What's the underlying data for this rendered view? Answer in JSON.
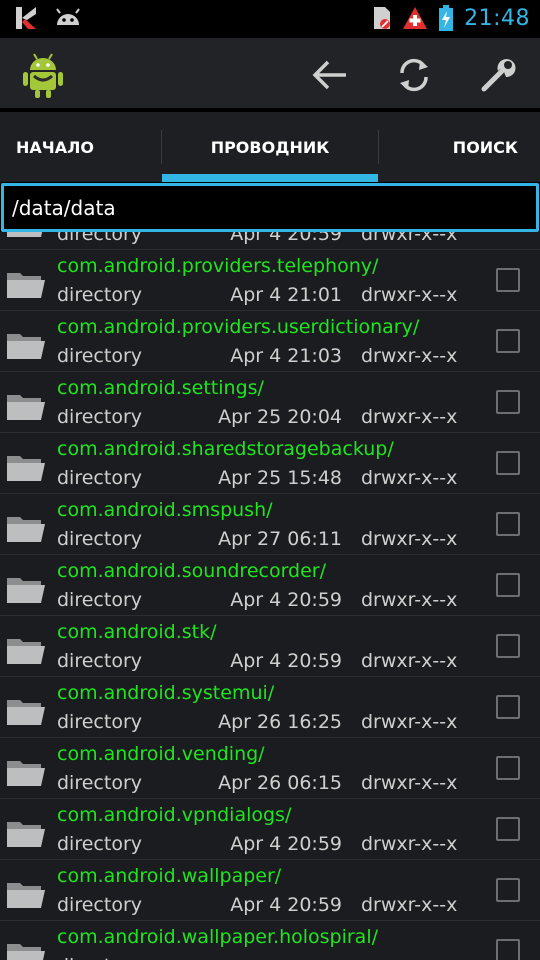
{
  "status_bar": {
    "time": "21:48",
    "icons": [
      "kaspersky-icon",
      "android-debug-icon",
      "sim-off-icon",
      "swiss-flag-icon",
      "battery-charging-icon"
    ]
  },
  "action_bar": {
    "icons": [
      "app-logo-icon",
      "back-arrow-icon",
      "refresh-icon",
      "settings-wrench-icon"
    ]
  },
  "tabs": [
    {
      "label": "НАЧАЛО",
      "active": false
    },
    {
      "label": "ПРОВОДНИК",
      "active": true
    },
    {
      "label": "ПОИСК",
      "active": false
    }
  ],
  "path": "/data/data",
  "files": [
    {
      "name": "",
      "type": "directory",
      "date": "Apr 4 20:59",
      "perm": "drwxr-x--x"
    },
    {
      "name": "com.android.providers.telephony/",
      "type": "directory",
      "date": "Apr 4 21:01",
      "perm": "drwxr-x--x"
    },
    {
      "name": "com.android.providers.userdictionary/",
      "type": "directory",
      "date": "Apr 4 21:03",
      "perm": "drwxr-x--x"
    },
    {
      "name": "com.android.settings/",
      "type": "directory",
      "date": "Apr 25 20:04",
      "perm": "drwxr-x--x"
    },
    {
      "name": "com.android.sharedstoragebackup/",
      "type": "directory",
      "date": "Apr 25 15:48",
      "perm": "drwxr-x--x"
    },
    {
      "name": "com.android.smspush/",
      "type": "directory",
      "date": "Apr 27 06:11",
      "perm": "drwxr-x--x"
    },
    {
      "name": "com.android.soundrecorder/",
      "type": "directory",
      "date": "Apr 4 20:59",
      "perm": "drwxr-x--x"
    },
    {
      "name": "com.android.stk/",
      "type": "directory",
      "date": "Apr 4 20:59",
      "perm": "drwxr-x--x"
    },
    {
      "name": "com.android.systemui/",
      "type": "directory",
      "date": "Apr 26 16:25",
      "perm": "drwxr-x--x"
    },
    {
      "name": "com.android.vending/",
      "type": "directory",
      "date": "Apr 26 06:15",
      "perm": "drwxr-x--x"
    },
    {
      "name": "com.android.vpndialogs/",
      "type": "directory",
      "date": "Apr 4 20:59",
      "perm": "drwxr-x--x"
    },
    {
      "name": "com.android.wallpaper/",
      "type": "directory",
      "date": "Apr 4 20:59",
      "perm": "drwxr-x--x"
    },
    {
      "name": "com.android.wallpaper.holospiral/",
      "type": "directory",
      "date": "",
      "perm": ""
    }
  ],
  "colors": {
    "accent": "#33b5e5",
    "file_name": "#1fe51f",
    "meta_text": "#cfcfcf",
    "background": "#1b1c1f"
  }
}
